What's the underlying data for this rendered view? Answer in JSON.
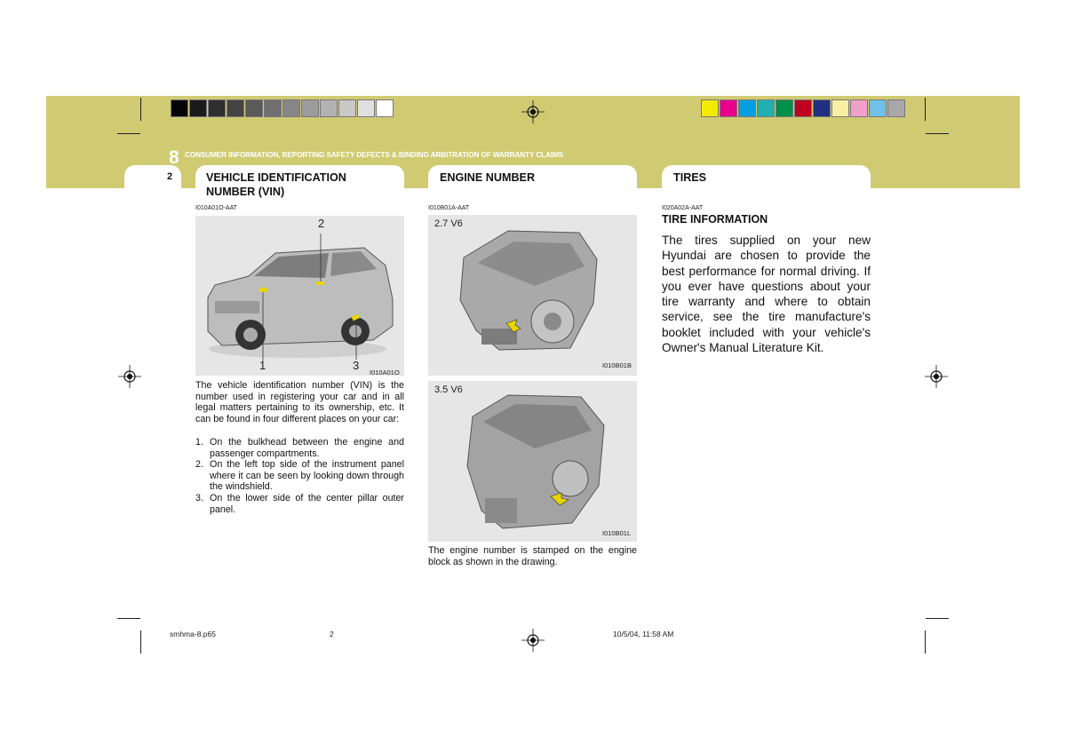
{
  "header": {
    "chapter_number": "8",
    "chapter_title": "CONSUMER INFORMATION, REPORTING SAFETY DEFECTS & BINDING ARBITRATION OF WARRANTY CLAIMS",
    "page_number": "2",
    "grayscale_swatches": [
      "#050505",
      "#1a1a1a",
      "#2e2e2e",
      "#444444",
      "#5a5a5a",
      "#707070",
      "#868686",
      "#9c9c9c",
      "#b2b2b2",
      "#c8c8c8",
      "#e0e0e0",
      "#ffffff"
    ],
    "color_swatches": [
      "#f4ea00",
      "#e8008a",
      "#00a0e0",
      "#20b0b0",
      "#009048",
      "#c00020",
      "#203080",
      "#f8f0a0",
      "#f0a0c8",
      "#70c0e8",
      "#a8a8a8"
    ]
  },
  "vin": {
    "title_line1": "VEHICLE IDENTIFICATION",
    "title_line2": "NUMBER (VIN)",
    "code": "I010A01O-AAT",
    "callout_1": "1",
    "callout_2": "2",
    "callout_3": "3",
    "fig_code": "I010A01O",
    "paragraph": "The vehicle identification number (VIN) is the number used in registering your car and in all legal matters pertaining to its ownership, etc. It can be found in four different places on your car:",
    "items": [
      {
        "num": "1.",
        "text": "On the bulkhead between the engine and passenger compartments."
      },
      {
        "num": "2.",
        "text": "On the left top side of the instrument panel where it can be seen by looking down through the windshield."
      },
      {
        "num": "3.",
        "text": "On the lower side of the center pillar outer panel."
      }
    ]
  },
  "engine": {
    "title": "ENGINE NUMBER",
    "code": "I010B01A-AAT",
    "fig1_label": "2.7 V6",
    "fig1_code": "I010B01B",
    "fig2_label": "3.5 V6",
    "fig2_code": "I010B01L",
    "paragraph": "The engine number is stamped on the engine block as shown in the drawing."
  },
  "tires": {
    "title": "TIRES",
    "code": "I020A02A-AAT",
    "subtitle": "TIRE INFORMATION",
    "paragraph": "The tires supplied on your new Hyundai are chosen to provide the best performance for normal driving. If you ever have questions about your tire warranty and where to obtain service, see the tire manufacture's booklet included with your vehicle's Owner's Manual Literature Kit."
  },
  "footer": {
    "file": "smhma-8.p65",
    "page": "2",
    "timestamp": "10/5/04, 11:58 AM"
  }
}
